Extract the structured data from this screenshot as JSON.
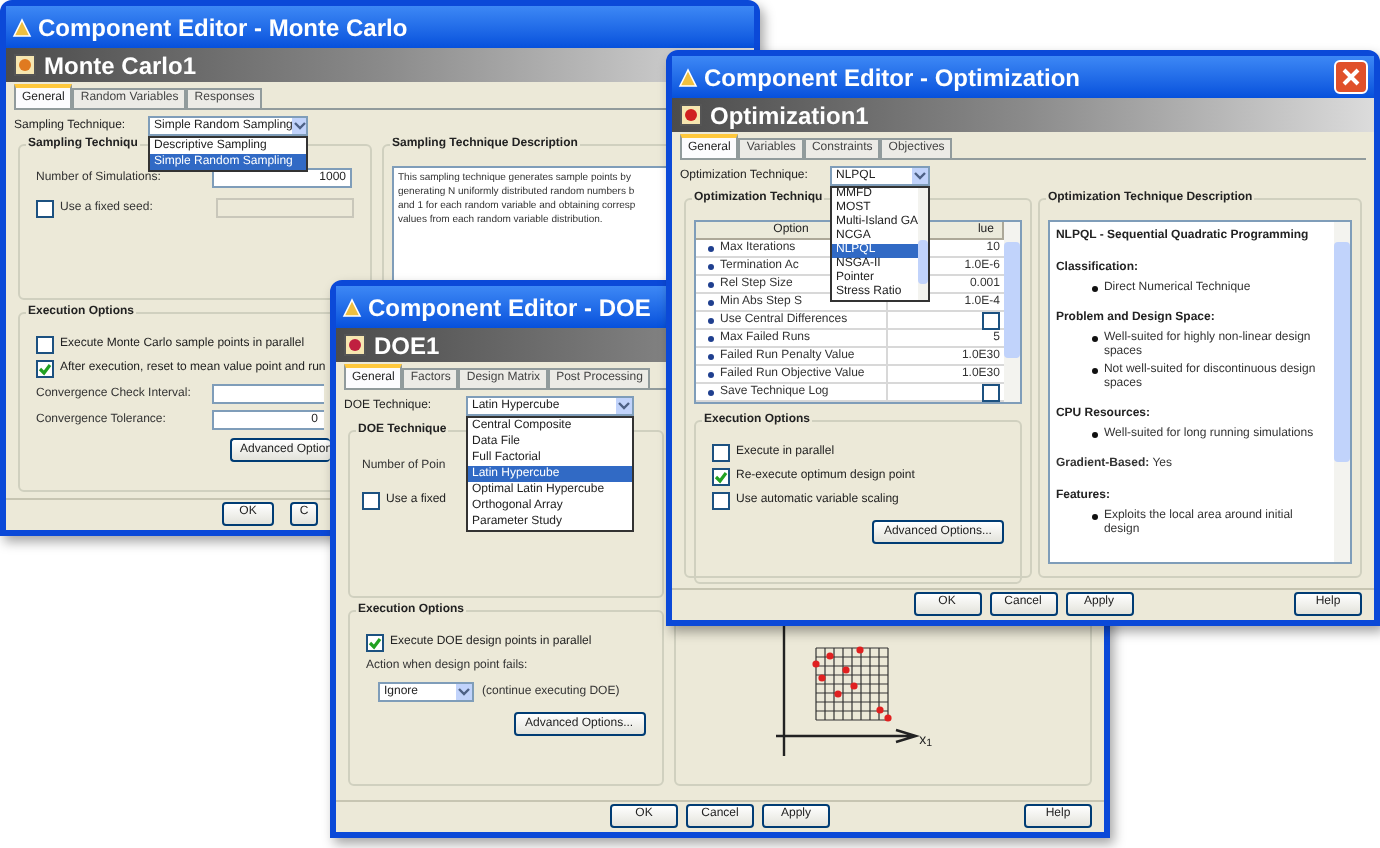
{
  "windows": [
    {
      "kind": "monte_carlo",
      "title": "Component Editor - Monte Carlo",
      "component": "Monte Carlo1",
      "tabs": [
        {
          "label": "General",
          "selected": true
        },
        {
          "label": "Random Variables",
          "selected": false
        },
        {
          "label": "Responses",
          "selected": false
        }
      ],
      "technique": {
        "label": "Sampling Technique:",
        "value": "Simple Random Sampling",
        "options": [
          {
            "label": "Descriptive Sampling",
            "selected": false
          },
          {
            "label": "Simple Random Sampling",
            "selected": true
          }
        ]
      },
      "technique_group": {
        "title": "Sampling Techniqu",
        "rows": [
          {
            "kind": "field",
            "label": "Number of Simulations:",
            "value": "1000"
          },
          {
            "kind": "checkbox",
            "label": "Use a fixed seed:",
            "checked": false
          }
        ]
      },
      "description": {
        "title": "Sampling Technique Description",
        "lines": [
          "This sampling technique generates sample points by",
          "generating N uniformly distributed random numbers b",
          "and 1 for each random variable and obtaining corresp",
          "values from each random variable distribution."
        ]
      },
      "execution": {
        "title": "Execution Options",
        "rows": [
          {
            "kind": "checkbox",
            "label": "Execute Monte Carlo sample points in parallel",
            "checked": false
          },
          {
            "kind": "checkbox",
            "label": "After execution, reset to mean value point and run",
            "checked": true
          },
          {
            "kind": "field",
            "label": "Convergence Check Interval:"
          },
          {
            "kind": "field",
            "label": "Convergence Tolerance:",
            "value": "0"
          }
        ],
        "advanced": "Advanced Option"
      },
      "buttons": [
        {
          "label": "OK",
          "kind": "main"
        },
        {
          "label": "C",
          "kind": "main"
        }
      ]
    },
    {
      "kind": "doe",
      "title": "Component Editor - DOE",
      "component": "DOE1",
      "tabs": [
        {
          "label": "General",
          "selected": true
        },
        {
          "label": "Factors",
          "selected": false
        },
        {
          "label": "Design Matrix",
          "selected": false
        },
        {
          "label": "Post Processing",
          "selected": false
        }
      ],
      "technique": {
        "label": "DOE Technique:",
        "value": "Latin Hypercube",
        "options": [
          {
            "label": "Central Composite",
            "selected": false
          },
          {
            "label": "Data File",
            "selected": false
          },
          {
            "label": "Full Factorial",
            "selected": false
          },
          {
            "label": "Latin Hypercube",
            "selected": true
          },
          {
            "label": "Optimal Latin Hypercube",
            "selected": false
          },
          {
            "label": "Orthogonal Array",
            "selected": false
          },
          {
            "label": "Parameter Study",
            "selected": false
          }
        ]
      },
      "technique_group": {
        "title": "DOE Technique",
        "rows": [
          {
            "kind": "text",
            "label": "Number of Poin"
          },
          {
            "kind": "checkbox",
            "label": "Use a fixed",
            "checked": false
          }
        ]
      },
      "plot": {
        "axis_label": "x$_{1}$"
      },
      "execution": {
        "title": "Execution Options",
        "rows": [
          {
            "kind": "checkbox",
            "label": "Execute DOE design points in parallel",
            "checked": true
          },
          {
            "kind": "text",
            "label": "Action when design point fails:"
          },
          {
            "kind": "select",
            "value": "Ignore",
            "note": "(continue executing DOE)"
          }
        ],
        "advanced": "Advanced Options..."
      },
      "buttons": [
        {
          "label": "OK",
          "kind": "main"
        },
        {
          "label": "Cancel",
          "kind": "main"
        },
        {
          "label": "Apply",
          "kind": "main"
        },
        {
          "label": "Help",
          "kind": "help"
        }
      ]
    },
    {
      "kind": "optimization",
      "title": "Component Editor - Optimization",
      "component": "Optimization1",
      "tabs": [
        {
          "label": "General",
          "selected": true
        },
        {
          "label": "Variables",
          "selected": false
        },
        {
          "label": "Constraints",
          "selected": false
        },
        {
          "label": "Objectives",
          "selected": false
        }
      ],
      "technique": {
        "label": "Optimization Technique:",
        "value": "NLPQL",
        "options": [
          {
            "label": "MMFD",
            "selected": false
          },
          {
            "label": "MOST",
            "selected": false
          },
          {
            "label": "Multi-Island GA",
            "selected": false
          },
          {
            "label": "NCGA",
            "selected": false
          },
          {
            "label": "NLPQL",
            "selected": true
          },
          {
            "label": "NSGA-II",
            "selected": false
          },
          {
            "label": "Pointer",
            "selected": false
          },
          {
            "label": "Stress Ratio",
            "selected": false
          }
        ]
      },
      "technique_group": {
        "title": "Optimization Techniqu",
        "columns": [
          "Option",
          "lue"
        ],
        "rows": [
          {
            "kind": "value",
            "label": "Max Iterations",
            "value": "10"
          },
          {
            "kind": "value",
            "label": "Termination Ac",
            "value": "1.0E-6"
          },
          {
            "kind": "value",
            "label": "Rel Step Size",
            "value": "0.001"
          },
          {
            "kind": "value",
            "label": "Min Abs Step S",
            "value": "1.0E-4"
          },
          {
            "kind": "checkbox",
            "label": "Use Central Differences",
            "checked": false
          },
          {
            "kind": "value",
            "label": "Max Failed Runs",
            "value": "5"
          },
          {
            "kind": "value",
            "label": "Failed Run Penalty Value",
            "value": "1.0E30"
          },
          {
            "kind": "value",
            "label": "Failed Run Objective Value",
            "value": "1.0E30"
          },
          {
            "kind": "checkbox",
            "label": "Save Technique Log",
            "checked": false
          }
        ]
      },
      "description": {
        "title": "Optimization Technique Description",
        "items": [
          {
            "kind": "heading",
            "text": "NLPQL - Sequential Quadratic Programming"
          },
          {
            "kind": "section",
            "text": "Classification:"
          },
          {
            "kind": "bullet",
            "text": "Direct Numerical Technique"
          },
          {
            "kind": "section",
            "text": "Problem and Design Space:"
          },
          {
            "kind": "bullet",
            "text": "Well-suited for highly non-linear design spaces"
          },
          {
            "kind": "bullet",
            "text": "Not well-suited for discontinuous design spaces"
          },
          {
            "kind": "section",
            "text": "CPU Resources:"
          },
          {
            "kind": "bullet",
            "text": "Well-suited for long running simulations"
          },
          {
            "kind": "text",
            "label": "Gradient-Based:",
            "value": "Yes"
          },
          {
            "kind": "section",
            "text": "Features:"
          },
          {
            "kind": "bullet",
            "text": "Exploits the local area around initial design"
          }
        ]
      },
      "execution": {
        "title": "Execution Options",
        "rows": [
          {
            "kind": "checkbox",
            "label": "Execute in parallel",
            "checked": false
          },
          {
            "kind": "checkbox",
            "label": "Re-execute optimum design point",
            "checked": true
          },
          {
            "kind": "checkbox",
            "label": "Use automatic variable scaling",
            "checked": false
          }
        ],
        "advanced": "Advanced Options..."
      },
      "buttons": [
        {
          "label": "OK",
          "kind": "main"
        },
        {
          "label": "Cancel",
          "kind": "main"
        },
        {
          "label": "Apply",
          "kind": "main"
        },
        {
          "label": "Help",
          "kind": "help"
        }
      ]
    }
  ]
}
